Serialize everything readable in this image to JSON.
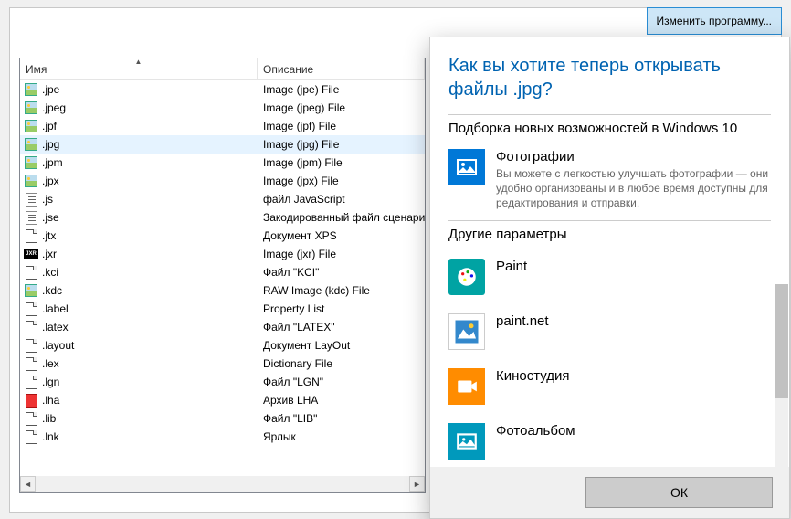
{
  "buttons": {
    "change_program": "Изменить программу...",
    "ok": "ОК"
  },
  "table": {
    "headers": {
      "name": "Имя",
      "description": "Описание"
    },
    "rows": [
      {
        "ext": ".jpe",
        "desc": "Image (jpe) File",
        "icon": "img"
      },
      {
        "ext": ".jpeg",
        "desc": "Image (jpeg) File",
        "icon": "img"
      },
      {
        "ext": ".jpf",
        "desc": "Image (jpf) File",
        "icon": "img"
      },
      {
        "ext": ".jpg",
        "desc": "Image (jpg) File",
        "icon": "img",
        "selected": true
      },
      {
        "ext": ".jpm",
        "desc": "Image (jpm) File",
        "icon": "img"
      },
      {
        "ext": ".jpx",
        "desc": "Image (jpx) File",
        "icon": "img"
      },
      {
        "ext": ".js",
        "desc": "файл JavaScript",
        "icon": "js"
      },
      {
        "ext": ".jse",
        "desc": "Закодированный файл сценария",
        "icon": "js"
      },
      {
        "ext": ".jtx",
        "desc": "Документ XPS",
        "icon": "page"
      },
      {
        "ext": ".jxr",
        "desc": "Image (jxr) File",
        "icon": "jxr"
      },
      {
        "ext": ".kci",
        "desc": "Файл \"KCI\"",
        "icon": "page"
      },
      {
        "ext": ".kdc",
        "desc": "RAW Image (kdc) File",
        "icon": "img"
      },
      {
        "ext": ".label",
        "desc": "Property List",
        "icon": "page"
      },
      {
        "ext": ".latex",
        "desc": "Файл \"LATEX\"",
        "icon": "page"
      },
      {
        "ext": ".layout",
        "desc": "Документ LayOut",
        "icon": "page"
      },
      {
        "ext": ".lex",
        "desc": "Dictionary File",
        "icon": "page"
      },
      {
        "ext": ".lgn",
        "desc": "Файл \"LGN\"",
        "icon": "page"
      },
      {
        "ext": ".lha",
        "desc": "Архив LHA",
        "icon": "lha"
      },
      {
        "ext": ".lib",
        "desc": "Файл \"LIB\"",
        "icon": "page"
      },
      {
        "ext": ".lnk",
        "desc": "Ярлык",
        "icon": "page"
      }
    ]
  },
  "dialog": {
    "title": "Как вы хотите теперь открывать файлы .jpg?",
    "section_featured": "Подборка новых возможностей в Windows 10",
    "section_other": "Другие параметры",
    "featured": {
      "name": "Фотографии",
      "desc": "Вы можете с легкостью улучшать фотографии — они удобно организованы и в любое время доступны для редактирования и отправки."
    },
    "apps": [
      {
        "name": "Paint",
        "icon": "paint"
      },
      {
        "name": "paint.net",
        "icon": "pdn"
      },
      {
        "name": "Киностудия",
        "icon": "movie"
      },
      {
        "name": "Фотоальбом",
        "icon": "photo2"
      }
    ]
  }
}
